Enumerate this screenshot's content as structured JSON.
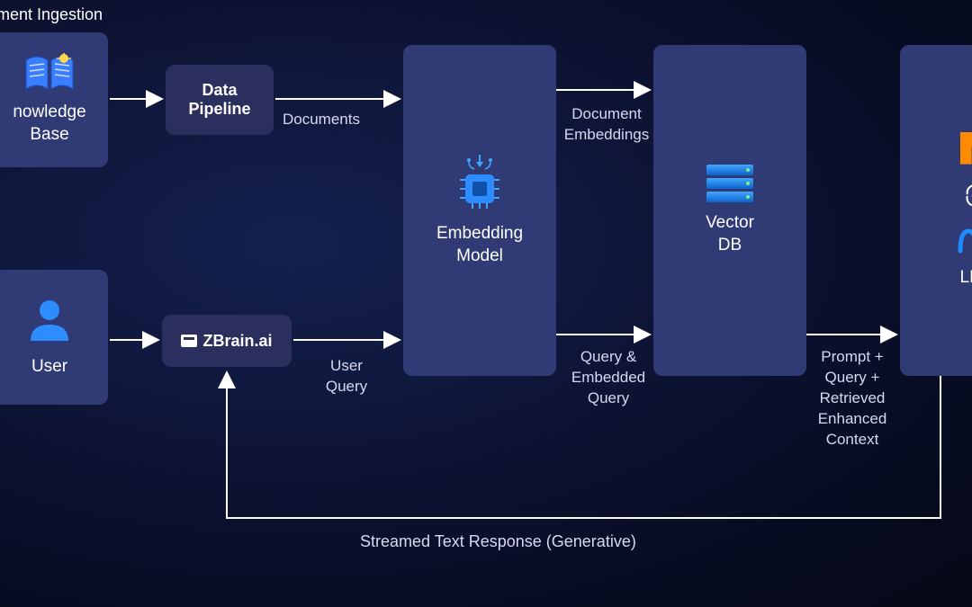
{
  "section": {
    "ingestion_title": "ment Ingestion"
  },
  "nodes": {
    "kb": {
      "label": "nowledge\nBase"
    },
    "pipeline": {
      "label": "Data\nPipeline"
    },
    "user": {
      "label": "User"
    },
    "zbrain": {
      "label": "ZBrain.ai"
    },
    "embedding": {
      "label": "Embedding\nModel"
    },
    "vector": {
      "label": "Vector\nDB"
    },
    "llm": {
      "label": "LLM"
    }
  },
  "edges": {
    "documents": "Documents",
    "doc_embeddings": "Document\nEmbeddings",
    "user_query": "User\nQuery",
    "query_embedded": "Query &\nEmbedded\nQuery",
    "prompt_context": "Prompt +\nQuery +\nRetrieved\nEnhanced\nContext",
    "streamed": "Streamed Text Response (Generative)"
  }
}
